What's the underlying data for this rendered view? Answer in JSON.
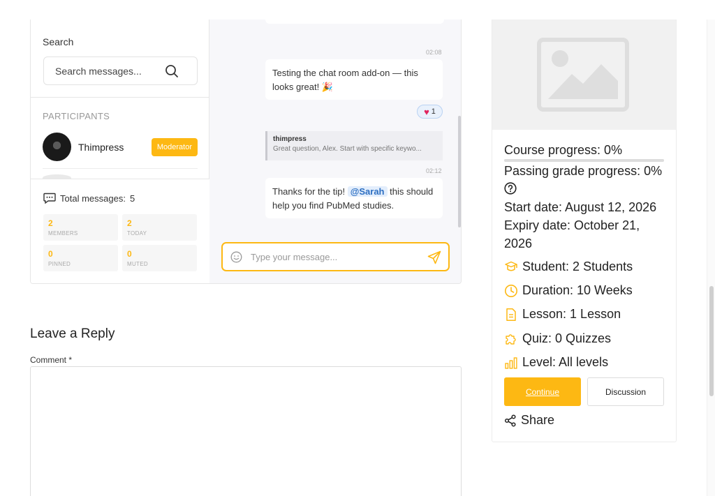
{
  "chat": {
    "search_label": "Search",
    "search_placeholder": "Search messages...",
    "participants_title": "PARTICIPANTS",
    "participants": [
      {
        "name": "Thimpress",
        "role_badge": "Moderator"
      }
    ],
    "total_messages_label": "Total messages:",
    "total_messages_value": "5",
    "stats": [
      {
        "value": "2",
        "label": "MEMBERS"
      },
      {
        "value": "2",
        "label": "TODAY"
      },
      {
        "value": "0",
        "label": "PINNED"
      },
      {
        "value": "0",
        "label": "MUTED"
      }
    ],
    "messages": [
      {
        "time": "02:08",
        "text": "Testing the chat room add-on — this looks great! 🎉",
        "reaction_count": "1"
      },
      {
        "time": "02:12",
        "quote_author": "thimpress",
        "quote_text": "Great question, Alex. Start with specific keywo...",
        "text_before": "Thanks for the tip!",
        "mention": "@Sarah",
        "text_after": "this should help you find PubMed studies."
      }
    ],
    "composer_placeholder": "Type your message..."
  },
  "reply": {
    "title": "Leave a Reply",
    "comment_label": "Comment *"
  },
  "course": {
    "course_progress": "Course progress: 0%",
    "course_progress_fraction": 0,
    "passing_grade": "Passing grade progress: 0%",
    "start_date": "Start date: August 12, 2026",
    "expiry_date": "Expiry date: October 21, 2026",
    "student": "Student: 2 Students",
    "duration": "Duration: 10 Weeks",
    "lesson": "Lesson: 1 Lesson",
    "quiz": "Quiz: 0 Quizzes",
    "level": "Level: All levels",
    "continue_label": "Continue",
    "discussion_label": "Discussion",
    "share_label": "Share"
  },
  "colors": {
    "accent": "#fdb813",
    "mention_bg": "#e3eefc",
    "mention_text": "#2d6fc2"
  }
}
